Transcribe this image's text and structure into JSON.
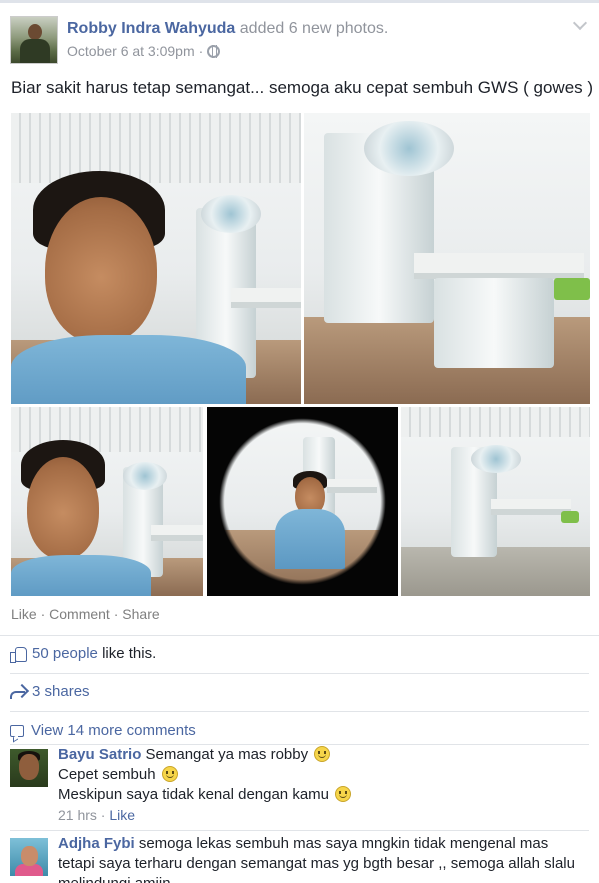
{
  "post": {
    "author_name": "Robby Indra Wahyuda",
    "action": "added 6 new photos.",
    "timestamp": "October 6 at 3:09pm",
    "separator": "·",
    "privacy_icon": "globe-icon",
    "options_icon": "chevron-down-icon",
    "status_text": "Biar sakit harus tetap semangat... semoga aku cepat sembuh GWS ( gowes )"
  },
  "photos": [
    {
      "name": "selfie-photo-1",
      "description_icon": "photo"
    },
    {
      "name": "radiotherapy-room-photo",
      "description_icon": "photo"
    },
    {
      "name": "selfie-photo-2",
      "description_icon": "photo"
    },
    {
      "name": "fisheye-selfie-photo",
      "description_icon": "photo"
    },
    {
      "name": "room-wide-photo",
      "description_icon": "photo"
    }
  ],
  "actions": {
    "like": "Like",
    "comment": "Comment",
    "share": "Share",
    "sep": " · "
  },
  "likes": {
    "count_link": "50 people",
    "suffix": "like this."
  },
  "shares": {
    "label": "3 shares"
  },
  "comments": {
    "view_more": "View 14 more comments",
    "items": [
      {
        "name": "Bayu Satrio",
        "line1": "Semangat ya mas robby",
        "line2": "Cepet sembuh",
        "line3": "Meskipun saya tidak kenal dengan kamu",
        "time": "21 hrs",
        "sep": " · ",
        "like": "Like"
      },
      {
        "name": "Adjha Fybi",
        "text": "semoga lekas sembuh mas saya mngkin tidak mengenal mas tetapi saya terharu dengan semangat mas yg bgth besar ,, semoga allah slalu melindungi amiin"
      }
    ]
  },
  "colors": {
    "link_blue": "#4b67a1",
    "muted_gray": "#90949c",
    "divider": "#e1e4e8"
  }
}
